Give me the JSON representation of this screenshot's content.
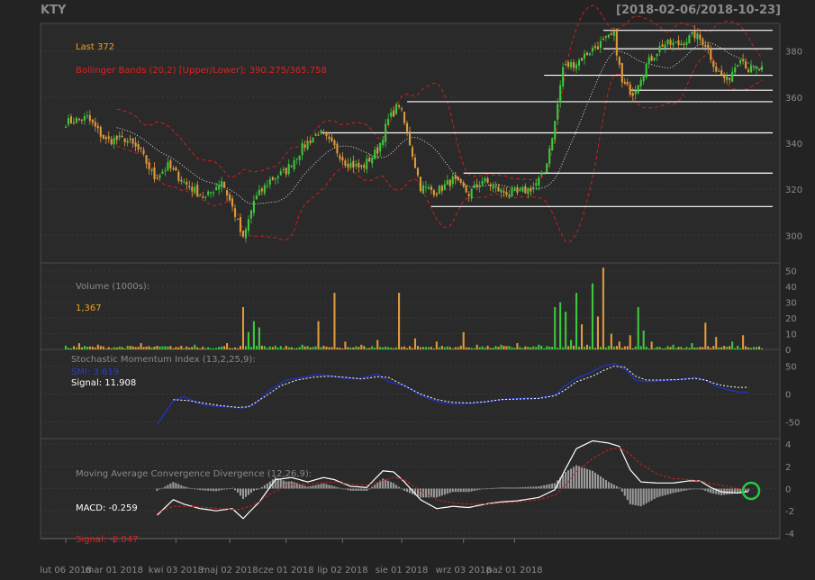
{
  "header": {
    "symbol": "KTY",
    "date_range": "[2018-02-06/2018-10-23]"
  },
  "colors": {
    "background": "#232323",
    "panel_bg": "#2a2a2a",
    "up": "#3cc83c",
    "down": "#e09a3c",
    "bbands": "#cc2020",
    "smi": "#2233bb",
    "macd_line": "#ffffff",
    "macd_signal": "#cc2020",
    "hist": "#9a9a9a",
    "text_orange": "#f0a020",
    "text_red": "#e02020",
    "text_gray": "#8a8a8a",
    "marker": "#22cc44"
  },
  "annotations": {
    "last": "Last 372",
    "bbands": "Bollinger Bands (20,2) [Upper/Lower]: 390.275/365.758",
    "volume_title": "Volume (1000s):",
    "volume_last": "1,367",
    "smi_title": "Stochastic Momentum Index (13,2,25,9):",
    "smi_value": "SMI: 3.619",
    "smi_signal": "Signal: 11.908",
    "macd_title": "Moving Average Convergence Divergence (12,26,9):",
    "macd_value": "MACD: -0.259",
    "macd_signal": "Signal: -0.047"
  },
  "chart_data": [
    {
      "type": "candlestick",
      "panel": "price",
      "ylim": [
        288,
        392
      ],
      "yticks": [
        "300",
        "320",
        "340",
        "360",
        "380"
      ],
      "close_anchors": [
        [
          0,
          349
        ],
        [
          8,
          351
        ],
        [
          15,
          341
        ],
        [
          22,
          342
        ],
        [
          28,
          336
        ],
        [
          33,
          325
        ],
        [
          38,
          330
        ],
        [
          45,
          322
        ],
        [
          52,
          316
        ],
        [
          58,
          324
        ],
        [
          63,
          309
        ],
        [
          66,
          298
        ],
        [
          70,
          315
        ],
        [
          76,
          324
        ],
        [
          82,
          328
        ],
        [
          88,
          338
        ],
        [
          94,
          345
        ],
        [
          100,
          338
        ],
        [
          104,
          332
        ],
        [
          110,
          329
        ],
        [
          116,
          337
        ],
        [
          120,
          350
        ],
        [
          124,
          357
        ],
        [
          128,
          340
        ],
        [
          132,
          321
        ],
        [
          138,
          319
        ],
        [
          144,
          324
        ],
        [
          150,
          318
        ],
        [
          155,
          324
        ],
        [
          162,
          319
        ],
        [
          168,
          318
        ],
        [
          174,
          321
        ],
        [
          178,
          327
        ],
        [
          182,
          349
        ],
        [
          185,
          373
        ],
        [
          190,
          375
        ],
        [
          195,
          380
        ],
        [
          200,
          384
        ],
        [
          204,
          387
        ],
        [
          207,
          366
        ],
        [
          211,
          362
        ],
        [
          216,
          374
        ],
        [
          222,
          383
        ],
        [
          228,
          383
        ],
        [
          234,
          387
        ],
        [
          238,
          383
        ],
        [
          242,
          372
        ],
        [
          246,
          367
        ],
        [
          251,
          378
        ],
        [
          254,
          372
        ]
      ],
      "hlines": [
        {
          "value": 389,
          "from": 200
        },
        {
          "value": 381,
          "from": 200
        },
        {
          "value": 369.5,
          "from": 178
        },
        {
          "value": 363,
          "from": 210
        },
        {
          "value": 358,
          "from": 127
        },
        {
          "value": 344.5,
          "from": 95
        },
        {
          "value": 327,
          "from": 148
        },
        {
          "value": 312.5,
          "from": 136
        }
      ]
    },
    {
      "type": "bar",
      "panel": "volume",
      "ylim": [
        0,
        55
      ],
      "yticks": [
        "0",
        "10",
        "20",
        "30",
        "40",
        "50"
      ],
      "spikes": [
        [
          5,
          4
        ],
        [
          12,
          3
        ],
        [
          28,
          4
        ],
        [
          48,
          3
        ],
        [
          60,
          4
        ],
        [
          66,
          27
        ],
        [
          68,
          11
        ],
        [
          70,
          18
        ],
        [
          72,
          14
        ],
        [
          88,
          3
        ],
        [
          94,
          18
        ],
        [
          100,
          36
        ],
        [
          104,
          5
        ],
        [
          110,
          3
        ],
        [
          116,
          6
        ],
        [
          124,
          36
        ],
        [
          130,
          7
        ],
        [
          138,
          5
        ],
        [
          148,
          11
        ],
        [
          153,
          3
        ],
        [
          162,
          3
        ],
        [
          168,
          4
        ],
        [
          176,
          3
        ],
        [
          182,
          27
        ],
        [
          184,
          30
        ],
        [
          186,
          24
        ],
        [
          188,
          6
        ],
        [
          190,
          36
        ],
        [
          192,
          16
        ],
        [
          194,
          3
        ],
        [
          196,
          42
        ],
        [
          198,
          21
        ],
        [
          200,
          52
        ],
        [
          203,
          10
        ],
        [
          206,
          5
        ],
        [
          210,
          9
        ],
        [
          213,
          27
        ],
        [
          215,
          12
        ],
        [
          218,
          5
        ],
        [
          226,
          3
        ],
        [
          233,
          4
        ],
        [
          238,
          17
        ],
        [
          242,
          8
        ],
        [
          248,
          5
        ],
        [
          252,
          9
        ]
      ]
    },
    {
      "type": "line",
      "panel": "smi",
      "ylim": [
        -80,
        80
      ],
      "yticks": [
        "-50",
        "0",
        "50"
      ],
      "series": [
        {
          "key": "smi",
          "anchors": [
            [
              34,
              -55
            ],
            [
              40,
              -12
            ],
            [
              44,
              -5
            ],
            [
              50,
              -18
            ],
            [
              56,
              -22
            ],
            [
              62,
              -24
            ],
            [
              66,
              -25
            ],
            [
              70,
              -20
            ],
            [
              76,
              8
            ],
            [
              82,
              25
            ],
            [
              88,
              30
            ],
            [
              94,
              35
            ],
            [
              100,
              32
            ],
            [
              104,
              28
            ],
            [
              110,
              29
            ],
            [
              116,
              36
            ],
            [
              120,
              22
            ],
            [
              126,
              15
            ],
            [
              132,
              -2
            ],
            [
              138,
              -14
            ],
            [
              144,
              -18
            ],
            [
              150,
              -17
            ],
            [
              156,
              -14
            ],
            [
              162,
              -10
            ],
            [
              168,
              -8
            ],
            [
              176,
              -7
            ],
            [
              182,
              -2
            ],
            [
              185,
              12
            ],
            [
              190,
              28
            ],
            [
              195,
              38
            ],
            [
              200,
              50
            ],
            [
              204,
              55
            ],
            [
              208,
              45
            ],
            [
              212,
              25
            ],
            [
              216,
              22
            ],
            [
              222,
              24
            ],
            [
              228,
              26
            ],
            [
              234,
              30
            ],
            [
              238,
              25
            ],
            [
              242,
              14
            ],
            [
              246,
              8
            ],
            [
              250,
              4
            ],
            [
              254,
              3
            ]
          ]
        },
        {
          "key": "signal",
          "anchors": [
            [
              40,
              -10
            ],
            [
              46,
              -12
            ],
            [
              52,
              -17
            ],
            [
              58,
              -21
            ],
            [
              64,
              -24
            ],
            [
              68,
              -23
            ],
            [
              74,
              -5
            ],
            [
              80,
              15
            ],
            [
              86,
              25
            ],
            [
              92,
              30
            ],
            [
              98,
              32
            ],
            [
              104,
              30
            ],
            [
              110,
              27
            ],
            [
              116,
              31
            ],
            [
              120,
              30
            ],
            [
              126,
              15
            ],
            [
              132,
              0
            ],
            [
              138,
              -10
            ],
            [
              144,
              -15
            ],
            [
              150,
              -16
            ],
            [
              156,
              -14
            ],
            [
              162,
              -10
            ],
            [
              168,
              -9
            ],
            [
              176,
              -8
            ],
            [
              182,
              -3
            ],
            [
              186,
              8
            ],
            [
              190,
              22
            ],
            [
              196,
              32
            ],
            [
              200,
              42
            ],
            [
              204,
              50
            ],
            [
              208,
              48
            ],
            [
              212,
              32
            ],
            [
              216,
              25
            ],
            [
              222,
              25
            ],
            [
              228,
              26
            ],
            [
              234,
              28
            ],
            [
              238,
              25
            ],
            [
              242,
              18
            ],
            [
              246,
              14
            ],
            [
              250,
              12
            ],
            [
              254,
              12
            ]
          ]
        }
      ]
    },
    {
      "type": "line",
      "panel": "macd",
      "ylim": [
        -4.5,
        4.5
      ],
      "yticks": [
        "-4",
        "-2",
        "0",
        "2",
        "4"
      ],
      "series": [
        {
          "key": "macd",
          "anchors": [
            [
              34,
              -2.4
            ],
            [
              40,
              -1.0
            ],
            [
              44,
              -1.4
            ],
            [
              50,
              -1.8
            ],
            [
              56,
              -2.0
            ],
            [
              62,
              -1.8
            ],
            [
              66,
              -2.7
            ],
            [
              72,
              -1.2
            ],
            [
              78,
              0.8
            ],
            [
              84,
              1.0
            ],
            [
              90,
              0.6
            ],
            [
              96,
              1.0
            ],
            [
              100,
              0.8
            ],
            [
              106,
              0.2
            ],
            [
              112,
              0.1
            ],
            [
              118,
              1.6
            ],
            [
              122,
              1.5
            ],
            [
              126,
              0.6
            ],
            [
              132,
              -1.0
            ],
            [
              138,
              -1.8
            ],
            [
              144,
              -1.6
            ],
            [
              150,
              -1.7
            ],
            [
              156,
              -1.4
            ],
            [
              162,
              -1.2
            ],
            [
              168,
              -1.1
            ],
            [
              176,
              -0.8
            ],
            [
              182,
              -0.1
            ],
            [
              186,
              1.8
            ],
            [
              190,
              3.6
            ],
            [
              196,
              4.3
            ],
            [
              202,
              4.1
            ],
            [
              206,
              3.8
            ],
            [
              210,
              1.7
            ],
            [
              214,
              0.6
            ],
            [
              220,
              0.5
            ],
            [
              226,
              0.5
            ],
            [
              232,
              0.7
            ],
            [
              236,
              0.7
            ],
            [
              240,
              0.1
            ],
            [
              244,
              -0.3
            ],
            [
              250,
              -0.4
            ],
            [
              254,
              -0.26
            ]
          ]
        },
        {
          "key": "signal",
          "anchors": [
            [
              34,
              -2.2
            ],
            [
              40,
              -1.6
            ],
            [
              46,
              -1.6
            ],
            [
              52,
              -1.7
            ],
            [
              58,
              -1.8
            ],
            [
              64,
              -1.9
            ],
            [
              70,
              -1.5
            ],
            [
              76,
              -0.5
            ],
            [
              82,
              0.3
            ],
            [
              88,
              0.4
            ],
            [
              94,
              0.5
            ],
            [
              100,
              0.6
            ],
            [
              106,
              0.4
            ],
            [
              112,
              0.3
            ],
            [
              118,
              0.7
            ],
            [
              122,
              1.0
            ],
            [
              126,
              0.8
            ],
            [
              132,
              -0.2
            ],
            [
              138,
              -1.0
            ],
            [
              144,
              -1.3
            ],
            [
              150,
              -1.4
            ],
            [
              156,
              -1.4
            ],
            [
              162,
              -1.3
            ],
            [
              168,
              -1.2
            ],
            [
              176,
              -1.0
            ],
            [
              182,
              -0.6
            ],
            [
              186,
              0.3
            ],
            [
              190,
              1.5
            ],
            [
              196,
              2.7
            ],
            [
              202,
              3.5
            ],
            [
              206,
              3.7
            ],
            [
              210,
              3.1
            ],
            [
              214,
              2.2
            ],
            [
              220,
              1.3
            ],
            [
              226,
              0.9
            ],
            [
              232,
              0.8
            ],
            [
              236,
              0.7
            ],
            [
              240,
              0.5
            ],
            [
              244,
              0.3
            ],
            [
              250,
              0.0
            ],
            [
              254,
              -0.05
            ]
          ]
        }
      ]
    }
  ],
  "x_axis": {
    "count": 260,
    "labels": [
      {
        "text": "lut 06 2018",
        "index": 0
      },
      {
        "text": "mar 01 2018",
        "index": 18
      },
      {
        "text": "kwi 03 2018",
        "index": 41
      },
      {
        "text": "maj 02 2018",
        "index": 61
      },
      {
        "text": "cze 01 2018",
        "index": 82
      },
      {
        "text": "lip 02 2018",
        "index": 103
      },
      {
        "text": "sie 01 2018",
        "index": 125
      },
      {
        "text": "wrz 03 2018",
        "index": 148
      },
      {
        "text": "paź 01 2018",
        "index": 167
      }
    ]
  }
}
